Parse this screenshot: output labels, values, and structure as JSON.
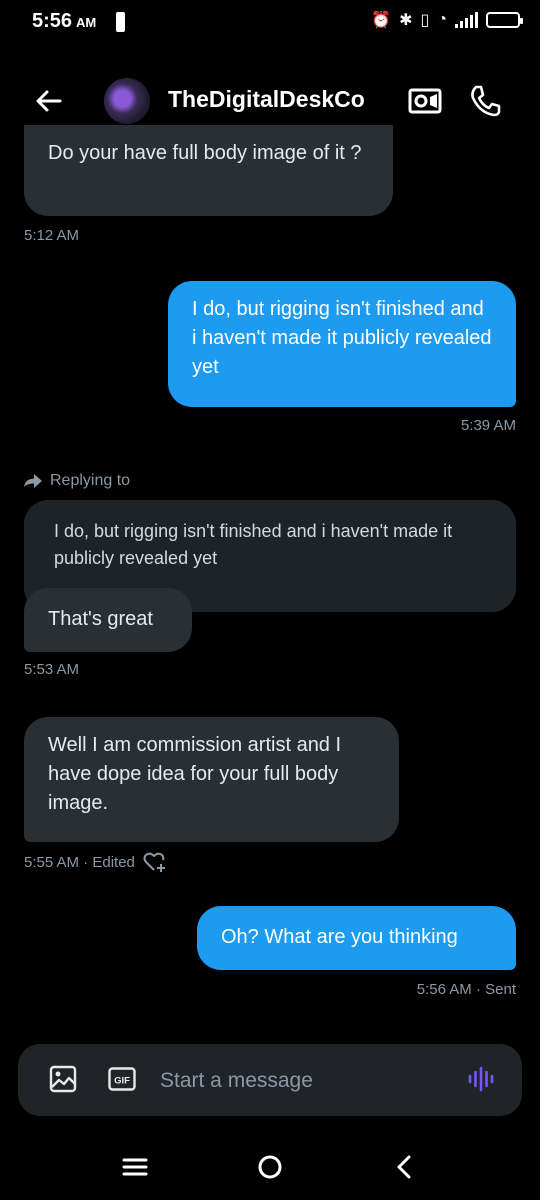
{
  "status_bar": {
    "time": "5:56",
    "ampm": "AM"
  },
  "header": {
    "title": "TheDigitalDeskCo"
  },
  "messages": {
    "m1": {
      "text": "Do your have full body image of it ?",
      "meta": "5:12 AM"
    },
    "m2": {
      "text": "I do, but rigging isn't finished and i haven't made it publicly revealed yet",
      "meta": "5:39 AM"
    },
    "reply": {
      "label": "Replying to",
      "quote": "I do, but rigging isn't finished and i haven't made it publicly revealed yet",
      "text": "That's great",
      "meta": "5:53 AM"
    },
    "m4": {
      "text": "Well I am commission artist and I have  dope idea for your full body image.",
      "meta": "5:55 AM · Edited"
    },
    "m5": {
      "text": "Oh? What are you thinking",
      "meta": "5:56 AM · Sent"
    }
  },
  "composer": {
    "placeholder": "Start a message",
    "gif_label": "GIF"
  },
  "colors": {
    "accent": "#1d9bf0",
    "received_bubble": "#283036",
    "voice": "#7856ff"
  },
  "icons": [
    "back-arrow-icon",
    "video-call-icon",
    "phone-icon",
    "reply-arrow-icon",
    "add-reaction-icon",
    "image-icon",
    "gif-icon",
    "voice-wave-icon",
    "menu-icon",
    "home-circle-icon",
    "back-chevron-icon"
  ]
}
